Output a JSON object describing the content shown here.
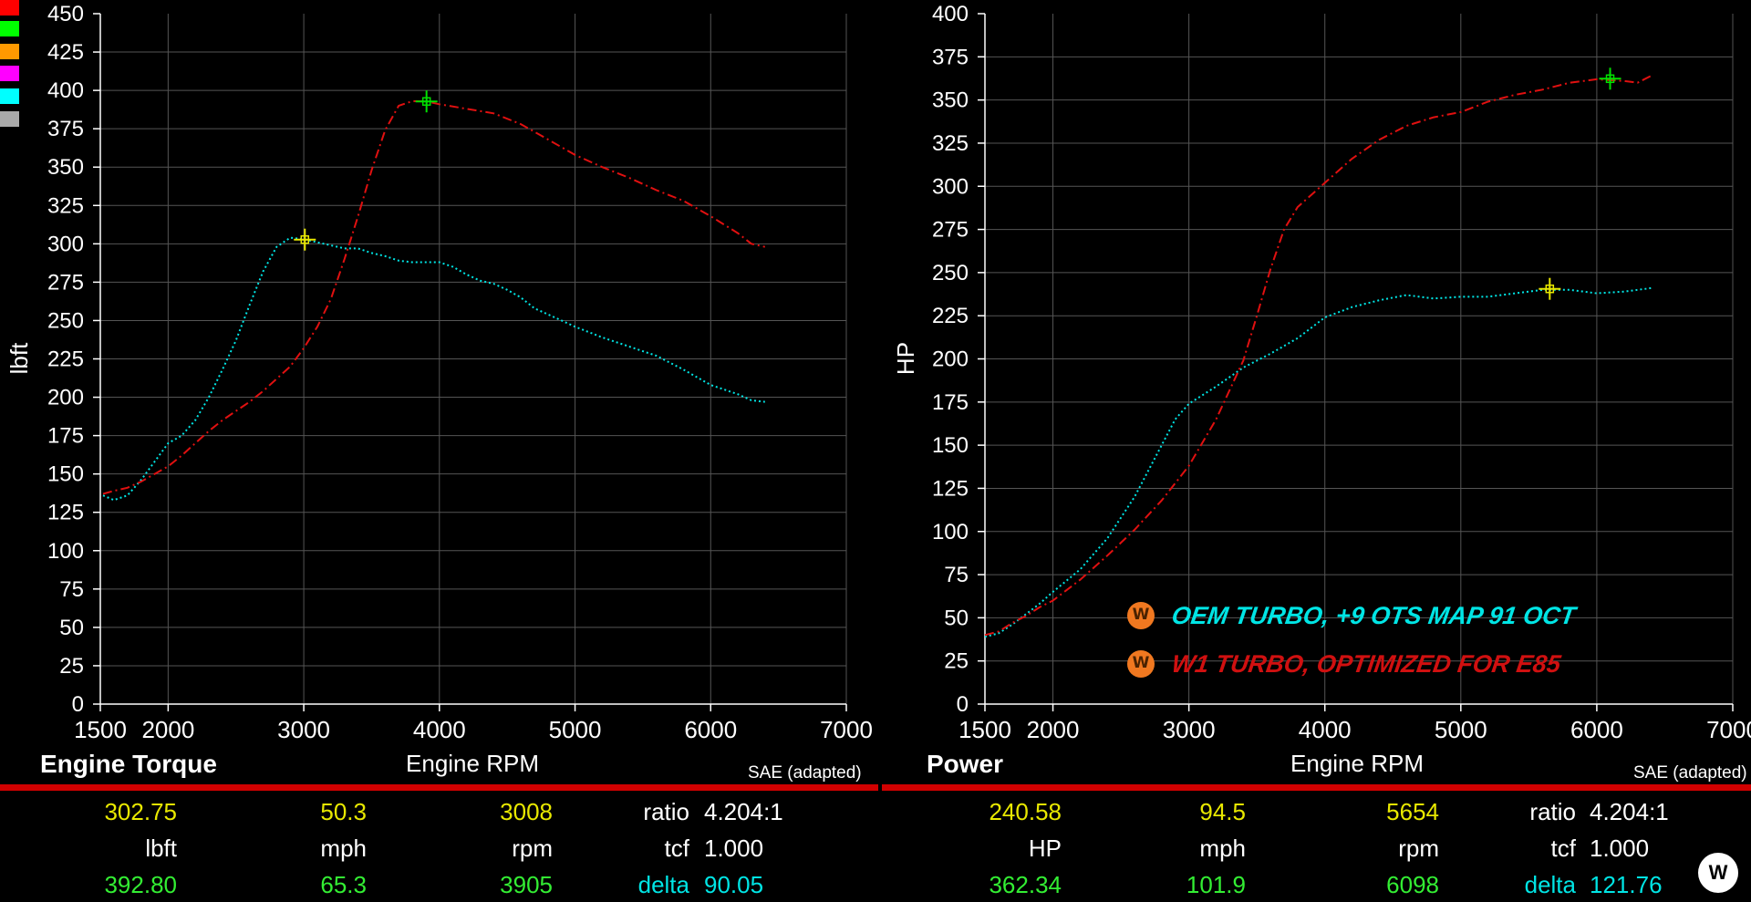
{
  "swatches": [
    "#ff0000",
    "#00ff00",
    "#ff9900",
    "#ff00ff",
    "#00ffff",
    "#aaaaaa"
  ],
  "chart_data": [
    {
      "type": "line",
      "title": "Engine Torque",
      "xlabel": "Engine RPM",
      "ylabel": "lbft",
      "note": "SAE (adapted)",
      "xlim": [
        1500,
        7000
      ],
      "ylim": [
        0,
        450
      ],
      "xticks": [
        1500,
        2000,
        3000,
        4000,
        5000,
        6000,
        7000
      ],
      "yticks": [
        0,
        25,
        50,
        75,
        100,
        125,
        150,
        175,
        200,
        225,
        250,
        275,
        300,
        325,
        350,
        375,
        400,
        425,
        450
      ],
      "grid": true,
      "series": [
        {
          "name": "OEM TURBO, +9 OTS MAP 91 OCT",
          "color": "#00e5e5",
          "style": "dotted",
          "marker": {
            "x": 3008,
            "y": 302.75,
            "color": "#e8e800"
          },
          "x": [
            1520,
            1600,
            1700,
            1800,
            1900,
            2000,
            2100,
            2200,
            2300,
            2400,
            2500,
            2600,
            2700,
            2800,
            2900,
            3000,
            3100,
            3200,
            3300,
            3400,
            3500,
            3600,
            3700,
            3800,
            3900,
            4000,
            4100,
            4200,
            4300,
            4400,
            4500,
            4600,
            4700,
            4800,
            4900,
            5000,
            5200,
            5400,
            5600,
            5800,
            6000,
            6200,
            6300,
            6400
          ],
          "y": [
            136,
            133,
            136,
            146,
            158,
            170,
            175,
            185,
            200,
            218,
            237,
            260,
            282,
            298,
            304,
            303,
            301,
            299,
            297,
            297,
            294,
            292,
            289,
            288,
            288,
            288,
            285,
            280,
            276,
            274,
            270,
            265,
            258,
            254,
            250,
            246,
            239,
            233,
            227,
            218,
            208,
            202,
            198,
            197
          ]
        },
        {
          "name": "W1 TURBO, OPTIMIZED FOR E85",
          "color": "#e01010",
          "style": "dashdot",
          "marker": {
            "x": 3905,
            "y": 392.8,
            "color": "#00e000"
          },
          "x": [
            1520,
            1600,
            1700,
            1800,
            1900,
            2000,
            2100,
            2200,
            2300,
            2400,
            2500,
            2600,
            2700,
            2800,
            2900,
            3000,
            3100,
            3200,
            3300,
            3400,
            3500,
            3600,
            3700,
            3800,
            3905,
            4000,
            4200,
            4400,
            4600,
            4800,
            5000,
            5200,
            5400,
            5600,
            5800,
            6000,
            6200,
            6300,
            6400
          ],
          "y": [
            137,
            139,
            141,
            145,
            150,
            155,
            162,
            170,
            178,
            185,
            191,
            197,
            204,
            212,
            220,
            232,
            246,
            264,
            290,
            318,
            348,
            374,
            390,
            393,
            392.8,
            391,
            388,
            385,
            378,
            368,
            358,
            350,
            343,
            335,
            328,
            318,
            307,
            300,
            298
          ]
        }
      ]
    },
    {
      "type": "line",
      "title": "Power",
      "xlabel": "Engine RPM",
      "ylabel": "HP",
      "note": "SAE (adapted)",
      "xlim": [
        1500,
        7000
      ],
      "ylim": [
        0,
        400
      ],
      "xticks": [
        1500,
        2000,
        3000,
        4000,
        5000,
        6000,
        7000
      ],
      "yticks": [
        0,
        25,
        50,
        75,
        100,
        125,
        150,
        175,
        200,
        225,
        250,
        275,
        300,
        325,
        350,
        375,
        400
      ],
      "grid": true,
      "series": [
        {
          "name": "OEM TURBO, +9 OTS MAP 91 OCT",
          "color": "#00e5e5",
          "style": "dotted",
          "marker": {
            "x": 5654,
            "y": 240.58,
            "color": "#e8e800"
          },
          "x": [
            1500,
            1600,
            1700,
            1800,
            1900,
            2000,
            2200,
            2400,
            2600,
            2800,
            2900,
            3000,
            3200,
            3400,
            3600,
            3800,
            4000,
            4200,
            4400,
            4600,
            4800,
            5000,
            5200,
            5400,
            5600,
            5800,
            6000,
            6200,
            6400
          ],
          "y": [
            39,
            41,
            46,
            52,
            58,
            65,
            78,
            96,
            120,
            150,
            165,
            174,
            184,
            195,
            203,
            212,
            224,
            230,
            234,
            237,
            235,
            236,
            236,
            238,
            240,
            240,
            238,
            239,
            241
          ]
        },
        {
          "name": "W1 TURBO, OPTIMIZED FOR E85",
          "color": "#e01010",
          "style": "dashdot",
          "marker": {
            "x": 6098,
            "y": 362.34,
            "color": "#00e000"
          },
          "x": [
            1500,
            1600,
            1700,
            1800,
            1900,
            2000,
            2200,
            2400,
            2600,
            2800,
            3000,
            3200,
            3400,
            3500,
            3600,
            3700,
            3800,
            4000,
            4200,
            4400,
            4600,
            4800,
            5000,
            5200,
            5400,
            5600,
            5800,
            6000,
            6200,
            6300,
            6400
          ],
          "y": [
            40,
            42,
            47,
            51,
            56,
            60,
            72,
            86,
            101,
            118,
            138,
            165,
            199,
            225,
            252,
            275,
            288,
            302,
            316,
            327,
            335,
            340,
            343,
            349,
            353,
            356,
            360,
            362,
            361,
            360,
            364
          ]
        }
      ]
    }
  ],
  "panels": [
    {
      "title": "Engine Torque",
      "xlabel": "Engine RPM",
      "ylabel": "lbft",
      "note": "SAE (adapted)"
    },
    {
      "title": "Power",
      "xlabel": "Engine RPM",
      "ylabel": "HP",
      "note": "SAE (adapted)"
    }
  ],
  "legend": [
    {
      "text": "OEM TURBO, +9 OTS MAP 91 OCT",
      "color": "#00e5e5"
    },
    {
      "text": "W1 TURBO, OPTIMIZED FOR E85",
      "color": "#d01010"
    }
  ],
  "readouts": [
    {
      "row1": {
        "value": "302.75",
        "speed": "50.3",
        "rpm": "3008",
        "key": "ratio",
        "val": "4.204:1"
      },
      "row2": {
        "unit": "lbft",
        "speed_unit": "mph",
        "rpm_unit": "rpm",
        "key": "tcf",
        "val": "1.000"
      },
      "row3": {
        "value": "392.80",
        "speed": "65.3",
        "rpm": "3905",
        "key": "delta",
        "val": "90.05"
      }
    },
    {
      "row1": {
        "value": "240.58",
        "speed": "94.5",
        "rpm": "5654",
        "key": "ratio",
        "val": "4.204:1"
      },
      "row2": {
        "unit": "HP",
        "speed_unit": "mph",
        "rpm_unit": "rpm",
        "key": "tcf",
        "val": "1.000"
      },
      "row3": {
        "value": "362.34",
        "speed": "101.9",
        "rpm": "6098",
        "key": "delta",
        "val": "121.76"
      }
    }
  ],
  "logo_text": "W"
}
